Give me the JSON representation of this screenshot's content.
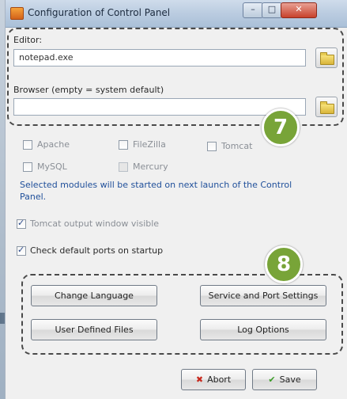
{
  "window": {
    "title": "Configuration of Control Panel",
    "controls": {
      "minimize": "–",
      "maximize": "□",
      "close": "✕"
    }
  },
  "editor": {
    "label": "Editor:",
    "value": "notepad.exe"
  },
  "browser": {
    "label": "Browser (empty = system default)",
    "value": ""
  },
  "callouts": {
    "top": "7",
    "bottom": "8"
  },
  "modules": {
    "items": [
      {
        "label": "Apache",
        "checked": false
      },
      {
        "label": "FileZilla",
        "checked": false
      },
      {
        "label": "Tomcat",
        "checked": false
      },
      {
        "label": "MySQL",
        "checked": false
      },
      {
        "label": "Mercury",
        "checked": false
      }
    ],
    "note": "Selected modules will be started on next launch of the Control Panel."
  },
  "options": {
    "tomcat_output": "Tomcat output window visible",
    "check_ports": "Check default ports on startup"
  },
  "buttons": {
    "change_language": "Change Language",
    "service_port": "Service and Port Settings",
    "user_files": "User Defined Files",
    "log_options": "Log Options",
    "abort": "Abort",
    "save": "Save"
  },
  "colors": {
    "callout": "#78a438",
    "note_text": "#1f4f9a"
  }
}
